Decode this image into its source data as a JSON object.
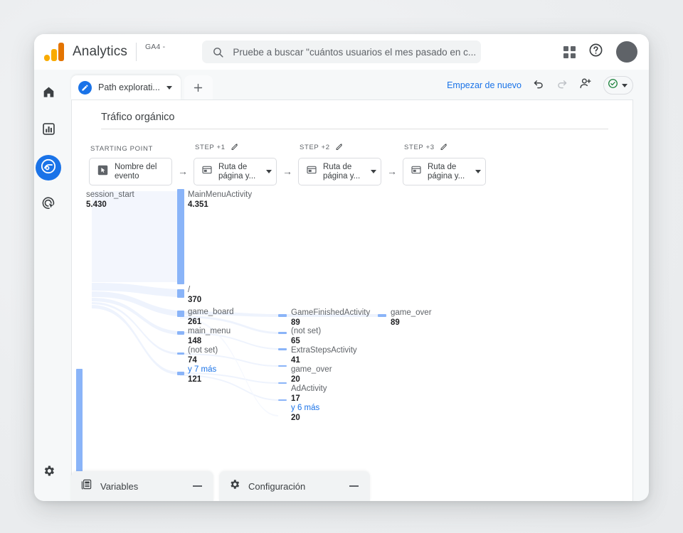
{
  "header": {
    "brand": "Analytics",
    "property_tag": "GA4 -",
    "search_placeholder": "Pruebe a buscar \"cuántos usuarios el mes pasado en c...",
    "search_icon": "search-icon",
    "apps_icon": "apps-grid-icon",
    "help_icon": "help-question-icon",
    "avatar_icon": "user-avatar"
  },
  "rail": {
    "items": [
      {
        "name": "home",
        "icon": "home-icon",
        "active": false
      },
      {
        "name": "reports",
        "icon": "bar-chart-icon",
        "active": false
      },
      {
        "name": "explore",
        "icon": "explore-compass-icon",
        "active": true
      },
      {
        "name": "advertising",
        "icon": "advertising-target-icon",
        "active": false
      }
    ],
    "settings": {
      "name": "admin",
      "icon": "gear-icon"
    }
  },
  "tabstrip": {
    "tab_label": "Path explorati...",
    "tab_icon": "pencil-circle-icon",
    "tab_caret": "chevron-down-icon",
    "add_tab_label": "+",
    "restart_label": "Empezar de nuevo",
    "undo_icon": "undo-icon",
    "redo_icon": "redo-icon",
    "share_icon": "person-add-icon",
    "status_icon": "green-check-circle-icon",
    "status_caret": "chevron-down-icon"
  },
  "canvas": {
    "title": "Tráfico orgánico",
    "steps": [
      {
        "header": "STARTING POINT",
        "value": "Nombre del evento",
        "icon": "event-cursor-icon",
        "has_pencil": false,
        "has_caret": false
      },
      {
        "header": "STEP +1",
        "value": "Ruta de página y...",
        "icon": "page-icon",
        "has_pencil": true,
        "has_caret": true
      },
      {
        "header": "STEP +2",
        "value": "Ruta de página y...",
        "icon": "page-icon",
        "has_pencil": true,
        "has_caret": true
      },
      {
        "header": "STEP +3",
        "value": "Ruta de página y...",
        "icon": "page-icon",
        "has_pencil": true,
        "has_caret": true
      }
    ],
    "step_arrow": "→",
    "pencil_icon": "pencil-icon"
  },
  "chart_data": {
    "type": "sankey",
    "title": "Tráfico orgánico",
    "colors": {
      "node": "#8ab4f8",
      "link": "#eaf0fd",
      "link_highlight": "#f3f6fd",
      "more_link": "#1a73e8"
    },
    "columns": [
      {
        "step": "STARTING POINT",
        "dimension": "Nombre del evento",
        "nodes": [
          {
            "label": "session_start",
            "value": "5.430",
            "number": 5430,
            "is_more": false
          }
        ]
      },
      {
        "step": "STEP +1",
        "dimension": "Ruta de página y...",
        "nodes": [
          {
            "label": "MainMenuActivity",
            "value": "4.351",
            "number": 4351,
            "is_more": false
          },
          {
            "label": "/",
            "value": "370",
            "number": 370,
            "is_more": false
          },
          {
            "label": "game_board",
            "value": "261",
            "number": 261,
            "is_more": false
          },
          {
            "label": "main_menu",
            "value": "148",
            "number": 148,
            "is_more": false
          },
          {
            "label": "(not set)",
            "value": "74",
            "number": 74,
            "is_more": false
          },
          {
            "label": "y 7 más",
            "value": "121",
            "number": 121,
            "is_more": true
          }
        ]
      },
      {
        "step": "STEP +2",
        "dimension": "Ruta de página y...",
        "nodes": [
          {
            "label": "GameFinishedActivity",
            "value": "89",
            "number": 89,
            "is_more": false
          },
          {
            "label": "(not set)",
            "value": "65",
            "number": 65,
            "is_more": false
          },
          {
            "label": "ExtraStepsActivity",
            "value": "41",
            "number": 41,
            "is_more": false
          },
          {
            "label": "game_over",
            "value": "20",
            "number": 20,
            "is_more": false
          },
          {
            "label": "AdActivity",
            "value": "17",
            "number": 17,
            "is_more": false
          },
          {
            "label": "y 6 más",
            "value": "20",
            "number": 20,
            "is_more": true
          }
        ]
      },
      {
        "step": "STEP +3",
        "dimension": "Ruta de página y...",
        "nodes": [
          {
            "label": "game_over",
            "value": "89",
            "number": 89,
            "is_more": false
          }
        ]
      }
    ]
  },
  "bottom": {
    "variables_label": "Variables",
    "variables_icon": "variables-panel-icon",
    "configuration_label": "Configuración",
    "configuration_icon": "gear-icon",
    "minimize_icon": "minimize-dash-icon"
  }
}
